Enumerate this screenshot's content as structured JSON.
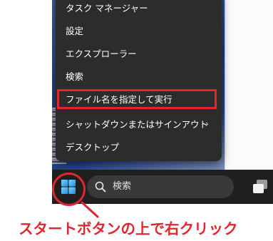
{
  "context_menu": {
    "items": [
      {
        "label": "タスク マネージャー",
        "has_submenu": false
      },
      {
        "label": "設定",
        "has_submenu": false
      },
      {
        "label": "エクスプローラー",
        "has_submenu": false
      },
      {
        "label": "検索",
        "has_submenu": false
      },
      {
        "label": "ファイル名を指定して実行",
        "has_submenu": false,
        "highlighted": true
      },
      {
        "label": "シャットダウンまたはサインアウト",
        "has_submenu": true
      },
      {
        "label": "デスクトップ",
        "has_submenu": false
      }
    ],
    "submenu_glyph": "›"
  },
  "taskbar": {
    "start_icon": "windows-logo-icon",
    "search_placeholder": "検索",
    "search_icon": "search-icon",
    "widget_icon": "task-view-icon"
  },
  "annotation": {
    "caption": "スタートボタンの上で右クリック",
    "accent_color": "#e0262f"
  }
}
